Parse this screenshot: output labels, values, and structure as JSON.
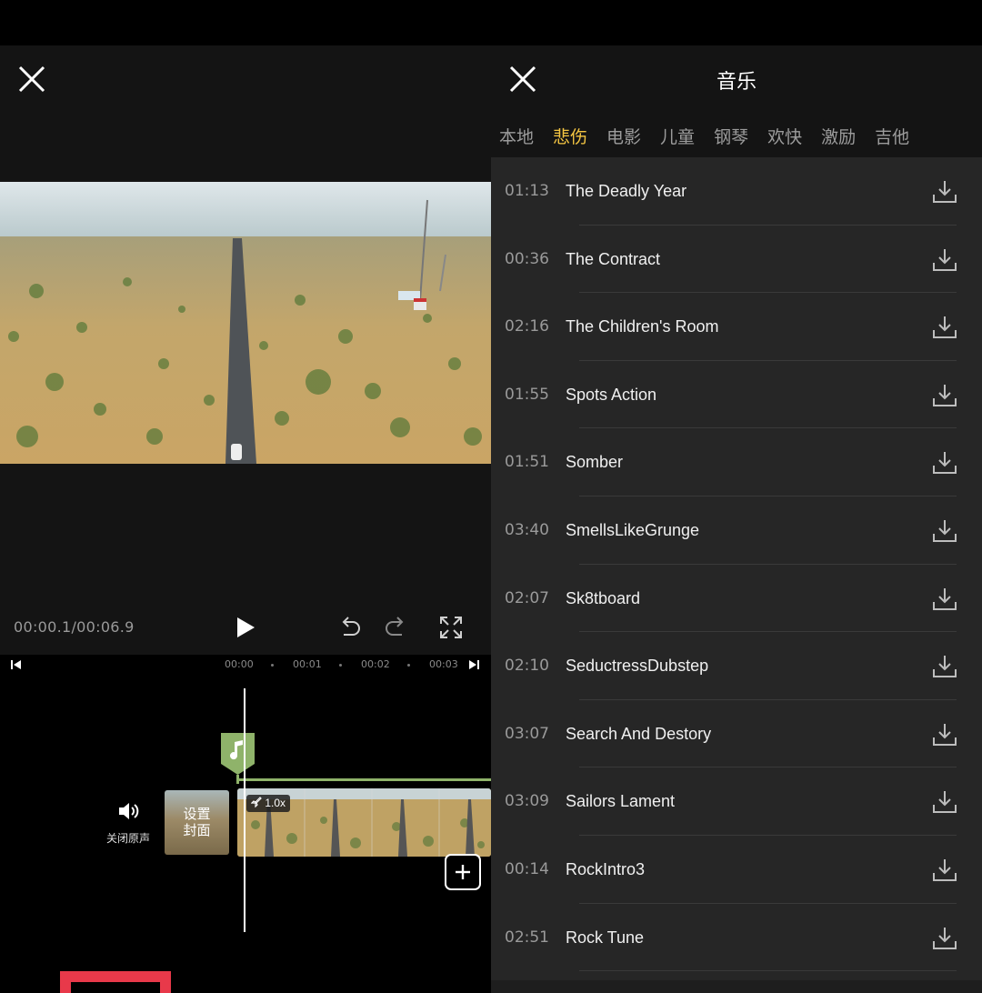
{
  "editor": {
    "timecode": "00:00.1/00:06.9",
    "ruler_ticks": [
      "00:00",
      "00:01",
      "00:02",
      "00:03"
    ],
    "mute_label": "关闭原声",
    "cover_label_line1": "设置",
    "cover_label_line2": "封面",
    "speed_label": "1.0x"
  },
  "music": {
    "title": "音乐",
    "tabs": [
      {
        "label": "本地",
        "active": false
      },
      {
        "label": "悲伤",
        "active": true
      },
      {
        "label": "电影",
        "active": false
      },
      {
        "label": "儿童",
        "active": false
      },
      {
        "label": "钢琴",
        "active": false
      },
      {
        "label": "欢快",
        "active": false
      },
      {
        "label": "激励",
        "active": false
      },
      {
        "label": "吉他",
        "active": false
      }
    ],
    "tracks": [
      {
        "duration": "01:13",
        "name": "The Deadly Year"
      },
      {
        "duration": "00:36",
        "name": "The Contract"
      },
      {
        "duration": "02:16",
        "name": "The Children's Room"
      },
      {
        "duration": "01:55",
        "name": "Spots Action"
      },
      {
        "duration": "01:51",
        "name": "Somber"
      },
      {
        "duration": "03:40",
        "name": "SmellsLikeGrunge"
      },
      {
        "duration": "02:07",
        "name": "Sk8tboard"
      },
      {
        "duration": "02:10",
        "name": "SeductressDubstep"
      },
      {
        "duration": "03:07",
        "name": "Search And Destory"
      },
      {
        "duration": "03:09",
        "name": "Sailors Lament"
      },
      {
        "duration": "00:14",
        "name": "RockIntro3"
      },
      {
        "duration": "02:51",
        "name": "Rock Tune"
      }
    ]
  },
  "colors": {
    "accent_tab": "#f4c542",
    "music_marker": "#8fb36a",
    "highlight_box": "#e8394a"
  }
}
